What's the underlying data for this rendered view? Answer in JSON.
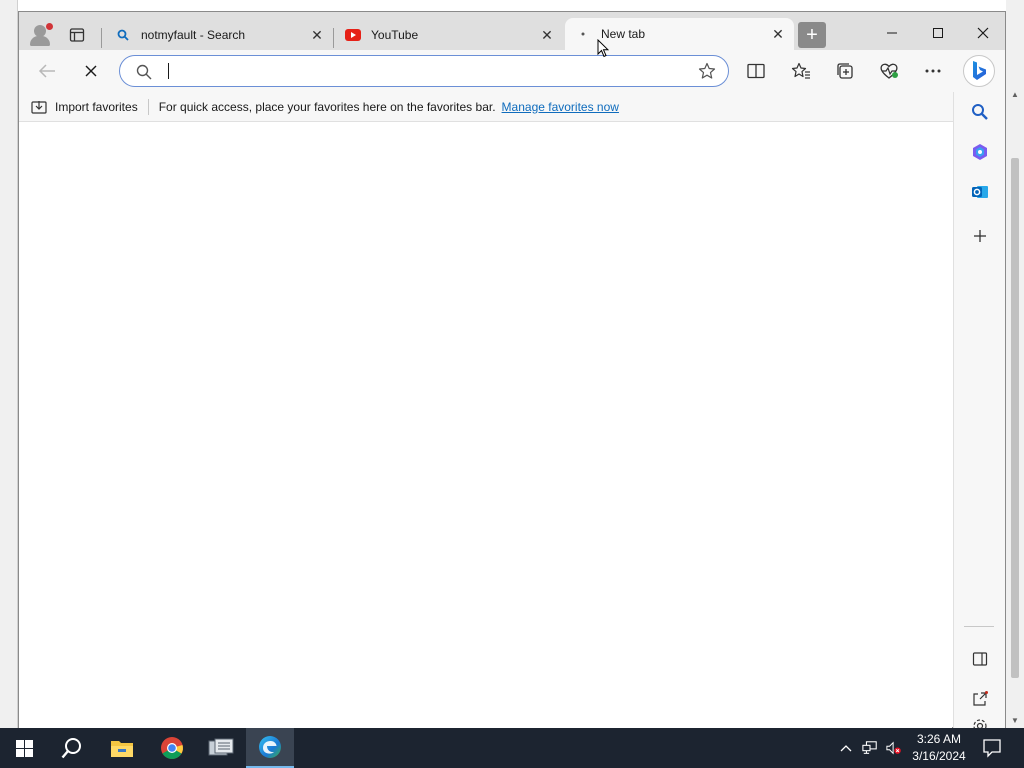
{
  "browser": {
    "tabs": [
      {
        "title": "notmyfault - Search",
        "favicon": "search-icon",
        "active": false
      },
      {
        "title": "YouTube",
        "favicon": "youtube-icon",
        "active": false
      },
      {
        "title": "New tab",
        "favicon": "loading-icon",
        "active": true
      }
    ],
    "address_bar": {
      "value": "",
      "placeholder": ""
    },
    "favorites_bar": {
      "import_label": "Import favorites",
      "hint_text": "For quick access, place your favorites here on the favorites bar.",
      "manage_link": "Manage favorites now"
    }
  },
  "taskbar": {
    "apps": [
      "windows-start-icon",
      "search-icon",
      "file-explorer-icon",
      "chrome-icon",
      "server-manager-icon",
      "edge-icon"
    ],
    "time": "3:26 AM",
    "date": "3/16/2024"
  },
  "colors": {
    "accent": "#0f6cbd",
    "address_border": "#6b8fd6",
    "taskbar_bg": "#1c2430",
    "tabstrip_bg": "#dfdfdf"
  }
}
